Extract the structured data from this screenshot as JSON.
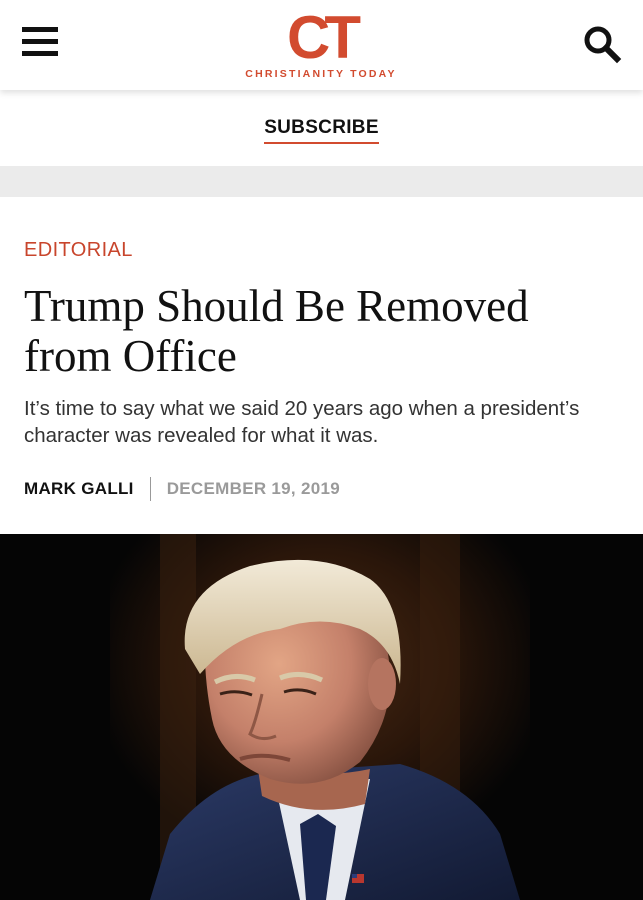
{
  "header": {
    "logo_mark": "CT",
    "logo_text": "CHRISTIANITY TODAY"
  },
  "subscribe": {
    "label": "SUBSCRIBE"
  },
  "article": {
    "section": "EDITORIAL",
    "headline": "Trump Should Be Removed from Office",
    "dek": "It’s time to say what we said 20 years ago when a president’s character was revealed for what it was.",
    "author": "MARK GALLI",
    "date": "DECEMBER 19, 2019"
  },
  "icons": {
    "menu": "hamburger-menu-icon",
    "search": "search-icon"
  },
  "colors": {
    "brand": "#d24b2f",
    "section": "#c8452c",
    "date": "#9a9a9a"
  }
}
